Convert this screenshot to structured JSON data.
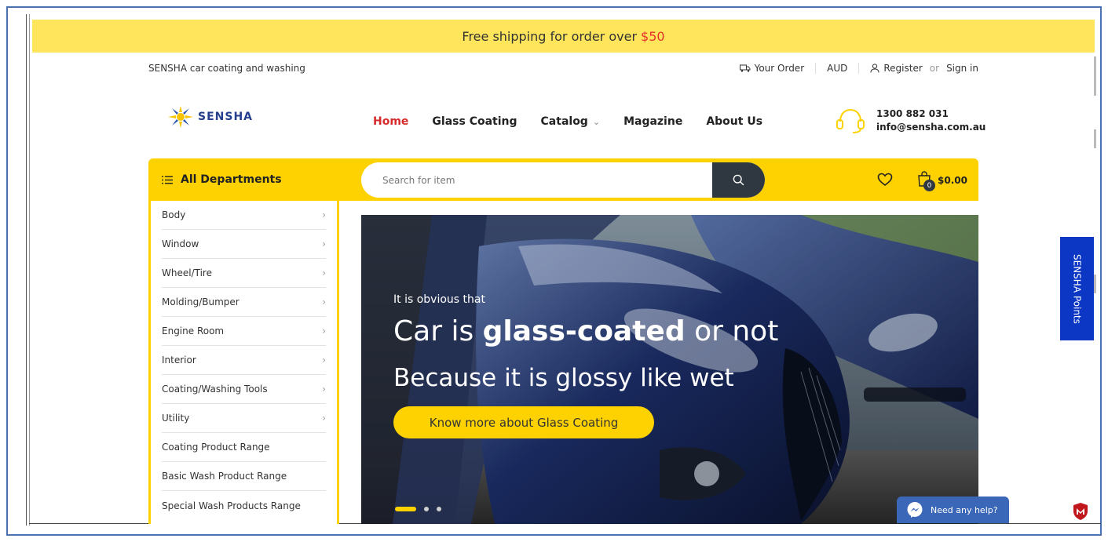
{
  "promo": {
    "text": "Free shipping for order over",
    "amount": "$50"
  },
  "topbar": {
    "tagline": "SENSHA car coating and washing",
    "your_order": "Your Order",
    "currency": "AUD",
    "register": "Register",
    "or": "or",
    "sign_in": "Sign in"
  },
  "logo": {
    "text": "SENSHA"
  },
  "nav": [
    {
      "label": "Home",
      "active": true
    },
    {
      "label": "Glass Coating"
    },
    {
      "label": "Catalog",
      "caret": true
    },
    {
      "label": "Magazine"
    },
    {
      "label": "About Us"
    }
  ],
  "contact": {
    "phone": "1300 882 031",
    "email": "info@sensha.com.au"
  },
  "departments": {
    "title": "All Departments",
    "items": [
      {
        "label": "Body",
        "arrow": true
      },
      {
        "label": "Window",
        "arrow": true
      },
      {
        "label": "Wheel/Tire",
        "arrow": true
      },
      {
        "label": "Molding/Bumper",
        "arrow": true
      },
      {
        "label": "Engine Room",
        "arrow": true
      },
      {
        "label": "Interior",
        "arrow": true
      },
      {
        "label": "Coating/Washing Tools",
        "arrow": true
      },
      {
        "label": "Utility",
        "arrow": true
      },
      {
        "label": "Coating Product Range",
        "arrow": false
      },
      {
        "label": "Basic Wash Product Range",
        "arrow": false
      },
      {
        "label": "Special Wash Products Range",
        "arrow": false
      }
    ]
  },
  "search": {
    "placeholder": "Search for item"
  },
  "cart": {
    "count": "0",
    "total": "$0.00"
  },
  "hero": {
    "pre": "It is obvious that",
    "line1_a": "Car is",
    "line1_b": "glass-coated",
    "line1_c": "or not",
    "line2": "Because it is glossy like wet",
    "cta": "Know more about Glass Coating",
    "slides": 3,
    "active_slide": 0
  },
  "side_tab": {
    "label": "SENSHA Points"
  },
  "chat": {
    "label": "Need any help?"
  },
  "colors": {
    "accent": "#fdd200",
    "dark": "#2f3840",
    "active_nav": "#d62c2c",
    "points_blue": "#0b37c4"
  }
}
